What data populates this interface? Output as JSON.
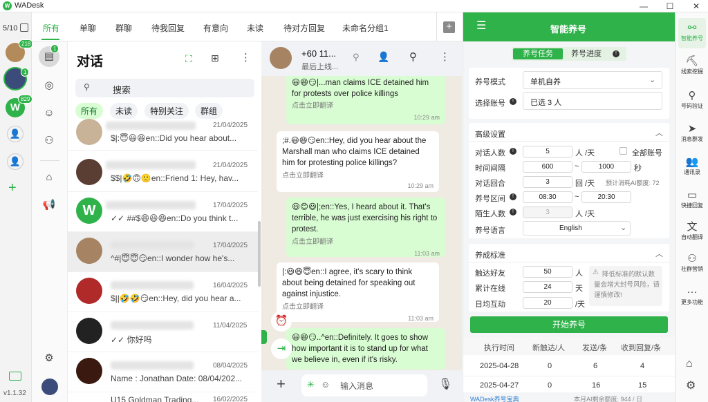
{
  "window": {
    "title": "WADesk",
    "logo": "W"
  },
  "rail": {
    "counter": "5/10",
    "badges": [
      "218",
      "1",
      "829"
    ],
    "version": "v1.1.32"
  },
  "tabs": [
    "所有",
    "单聊",
    "群聊",
    "待我回复",
    "有意向",
    "未读",
    "待对方回复",
    "未命名分组1"
  ],
  "chat_list": {
    "title": "对话",
    "badge": "1",
    "search_placeholder": "搜索",
    "filters": [
      "所有",
      "未读",
      "特别关注",
      "群组"
    ],
    "items": [
      {
        "date": "21/04/2025",
        "preview": "$|:😇😃😆en::Did you hear about..."
      },
      {
        "date": "21/04/2025",
        "preview": "$$|🤣🙃🙂en::Friend 1: Hey, hav..."
      },
      {
        "date": "17/04/2025",
        "preview": "✓✓ ##$😆😃😆en::Do you think t..."
      },
      {
        "date": "17/04/2025",
        "preview": "^#|😇😇😏en::I wonder how he's..."
      },
      {
        "date": "16/04/2025",
        "preview": "$||🤣🤣😏en::Hey, did you hear a..."
      },
      {
        "date": "11/04/2025",
        "preview": "✓✓ 你好吗"
      },
      {
        "date": "08/04/2025",
        "preview": "Name : Jonathan  Date: 08/04/202..."
      },
      {
        "date": "16/02/2025",
        "preview": "U15 Goldman Trading..."
      }
    ]
  },
  "conversation": {
    "contact_name": "+60 11...",
    "contact_status": "最后上线...",
    "messages": [
      {
        "dir": "out",
        "text": "😃😆😏|...man claims ICE detained him for protests over police killings",
        "translate": "点击立即翻译",
        "time": "10:29 am"
      },
      {
        "dir": "in",
        "text": ";#.😃😆😏en::Hey, did you hear about the Marshall man who claims ICE detained him for protesting police killings?",
        "translate": "点击立即翻译",
        "time": "10:29 am"
      },
      {
        "dir": "out",
        "text": "😃😊😃|;en::Yes, I heard about it. That's terrible, he was just exercising his right to protest.",
        "translate": "点击立即翻译",
        "time": "11:03 am"
      },
      {
        "dir": "in",
        "text": "|:😃😆😇en::I agree, it's scary to think about being detained for speaking out against injustice.",
        "translate": "点击立即翻译",
        "time": "11:03 am"
      },
      {
        "dir": "out",
        "text": "😃😆😏..^en::Definitely. It goes to show how important it is to stand up for what we believe in, even if it's risky.",
        "translate": "",
        "time": ""
      }
    ],
    "input_placeholder": "输入消息"
  },
  "panel": {
    "title": "智能养号",
    "tabs": [
      "养号任务",
      "养号进度"
    ],
    "mode_label": "养号模式",
    "mode_value": "单机自养",
    "account_label": "选择账号",
    "account_value": "已选 3 人",
    "advanced_title": "高级设置",
    "rows": [
      {
        "label": "对话人数",
        "v1": "5",
        "unit": "人 /天",
        "extra": "全部账号"
      },
      {
        "label": "时间间隔",
        "v1": "600",
        "v2": "1000",
        "unit": "秒"
      },
      {
        "label": "对话回合",
        "v1": "3",
        "unit": "回 /天",
        "extra": "预计消耗AI额度: 72"
      },
      {
        "label": "养号区间",
        "v1": "08:30",
        "v2": "20:30"
      },
      {
        "label": "陌生人数",
        "v1": "3",
        "unit": "人 /天"
      },
      {
        "label": "养号语言",
        "v1": "English"
      }
    ],
    "standard_title": "养成标准",
    "standards": [
      {
        "label": "触达好友",
        "value": "50",
        "unit": "人"
      },
      {
        "label": "累计在线",
        "value": "24",
        "unit": "天"
      },
      {
        "label": "日均互动",
        "value": "20",
        "unit": "/天"
      }
    ],
    "warning": "降低标准的默认数量会增大封号风险，请谨慎修改!",
    "start_button": "开始养号",
    "table_headers": [
      "执行时间",
      "新触达/人",
      "发送/条",
      "收到回复/条"
    ],
    "table_rows": [
      [
        "2025-04-28",
        "0",
        "6",
        "4"
      ],
      [
        "2025-04-27",
        "0",
        "16",
        "15"
      ]
    ],
    "footer_link": "WADesk养号宝典",
    "footer_quota": "本月AI剩余额度: 944 / 日"
  },
  "rightbar": [
    "智能养号",
    "线索挖掘",
    "号码验证",
    "消息群发",
    "通讯录",
    "快捷回复",
    "自动翻译",
    "社群营销",
    "更多功能"
  ],
  "colors": {
    "accent": "#2fb24a",
    "out_bubble": "#d9fdd3",
    "chat_bg": "#efeae2"
  }
}
